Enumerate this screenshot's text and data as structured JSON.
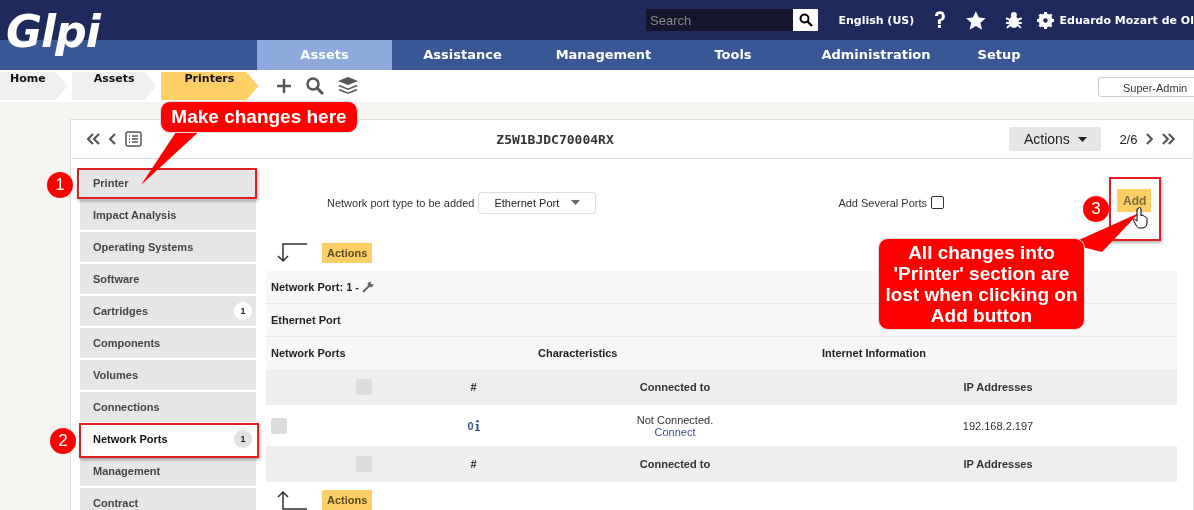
{
  "header": {
    "logo": "Glpi",
    "search": {
      "placeholder": "Search"
    },
    "language": "English (US)",
    "user": "Eduardo Mozart de Ol"
  },
  "nav": [
    {
      "label": "Assets",
      "selected": true
    },
    {
      "label": "Assistance",
      "selected": false
    },
    {
      "label": "Management",
      "selected": false
    },
    {
      "label": "Tools",
      "selected": false
    },
    {
      "label": "Administration",
      "selected": false
    },
    {
      "label": "Setup",
      "selected": false
    }
  ],
  "breadcrumbs": [
    {
      "label": "Home",
      "selected": false
    },
    {
      "label": "Assets",
      "selected": false
    },
    {
      "label": "Printers",
      "selected": true
    }
  ],
  "profile": "Super-Admin",
  "record": {
    "title": "Z5W1BJDC70004RX",
    "actions": "Actions",
    "pager": "2/6"
  },
  "sidebar": [
    {
      "label": "Printer",
      "selected": false
    },
    {
      "label": "Impact Analysis",
      "selected": false
    },
    {
      "label": "Operating Systems",
      "selected": false
    },
    {
      "label": "Software",
      "selected": false
    },
    {
      "label": "Cartridges",
      "selected": false,
      "badge": "1"
    },
    {
      "label": "Components",
      "selected": false
    },
    {
      "label": "Volumes",
      "selected": false
    },
    {
      "label": "Connections",
      "selected": false
    },
    {
      "label": "Network Ports",
      "selected": true,
      "badge": "1"
    },
    {
      "label": "Management",
      "selected": false
    },
    {
      "label": "Contract",
      "selected": false
    }
  ],
  "form": {
    "type_label": "Network port type to be added",
    "type_value": "Ethernet Port",
    "several_label": "Add Several Ports",
    "several_checked": false,
    "add": "Add"
  },
  "actions_top": "Actions",
  "actions_bottom": "Actions",
  "port": {
    "title": "Network Port: 1 -",
    "type": "Ethernet Port",
    "groups": [
      "Network Ports",
      "Characteristics",
      "Internet Information"
    ],
    "columns": [
      "#",
      "Connected to",
      "IP Addresses"
    ],
    "header_checked": false,
    "footer_columns": [
      "#",
      "Connected to",
      "IP Addresses"
    ],
    "footer_checked": false,
    "rows": [
      {
        "checked": false,
        "number": "0",
        "connected": "Not Connected.",
        "link": "Connect",
        "ip": "192.168.2.197"
      }
    ]
  },
  "annotations": [
    {
      "number": "1",
      "text": "Make changes here"
    },
    {
      "number": "2"
    },
    {
      "number": "3",
      "text": "All changes into 'Printer' section are lost when clicking on Add button"
    }
  ]
}
